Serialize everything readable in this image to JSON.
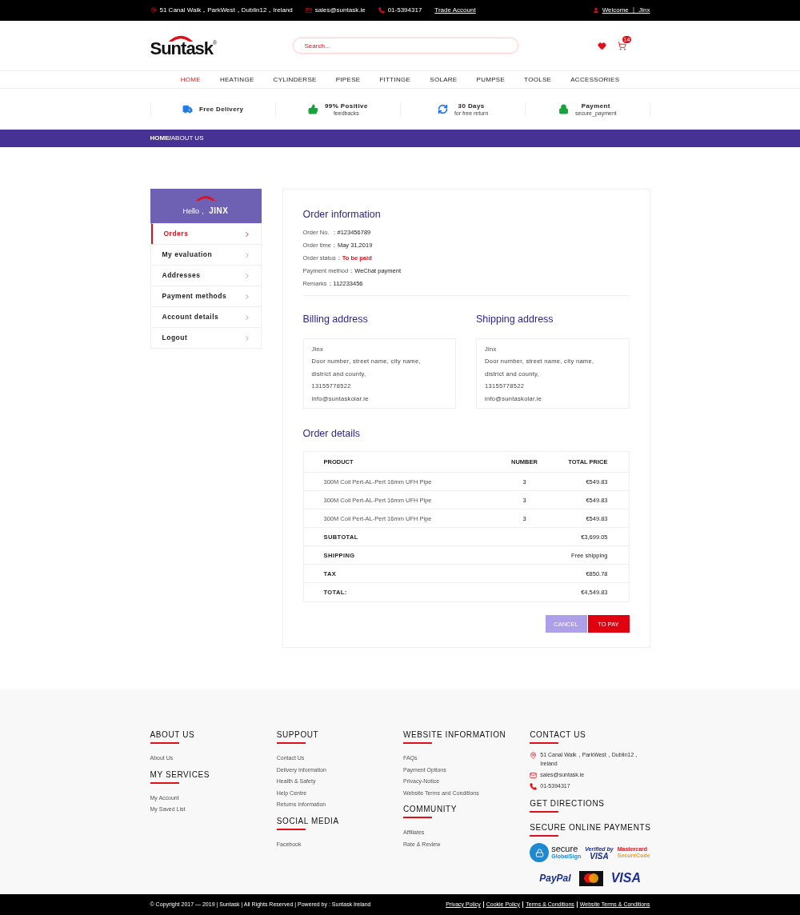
{
  "top_bar": {
    "address": "51 Canal Walk，ParkWest，Dublin12，Ireland",
    "email": "sales@suntask.ie",
    "phone": "01-5394317",
    "trade_account": "Trade Account",
    "welcome": "Welcome ｜ Jinx"
  },
  "header": {
    "logo": "Suntask",
    "logo_mark": "®",
    "search": {
      "placeholder": "Search..."
    },
    "cart_count": "14"
  },
  "nav": [
    {
      "label": "HOME",
      "selected": true
    },
    {
      "label": "HEATINGE",
      "selected": false
    },
    {
      "label": "CYLINDERSE",
      "selected": false
    },
    {
      "label": "PIPESE",
      "selected": false
    },
    {
      "label": "FITTINGE",
      "selected": false
    },
    {
      "label": "SOLARE",
      "selected": false
    },
    {
      "label": "PUMPSE",
      "selected": false
    },
    {
      "label": "TOOLSE",
      "selected": false
    },
    {
      "label": "ACCESSORIES",
      "selected": false
    }
  ],
  "features": [
    {
      "kind": "truck",
      "title": "Free Delivery"
    },
    {
      "kind": "thumb",
      "title": "99% Positive",
      "subtitle": "feedbacks"
    },
    {
      "kind": "refresh",
      "title": "30 Days",
      "subtitle": "for free return"
    },
    {
      "kind": "lock",
      "title": "Payment",
      "subtitle": "secure_payment"
    }
  ],
  "breadcrumb": "**HOME/**ABOUT US",
  "sidebar": {
    "greeting": "Hello，",
    "name": "JINX",
    "items": [
      {
        "label": "Orders",
        "selected": true
      },
      {
        "label": "My evaluation",
        "selected": false
      },
      {
        "label": "Addresses",
        "selected": false
      },
      {
        "label": "Payment methods",
        "selected": false
      },
      {
        "label": "Account details",
        "selected": false
      },
      {
        "label": "Logout",
        "selected": false
      }
    ]
  },
  "order_info": {
    "title": "Order information",
    "fields": [
      {
        "label": "Order No. ：",
        "value": "#123456789",
        "kind": "plain"
      },
      {
        "label": "Order time：",
        "value": "May 31,2019",
        "kind": "plain"
      },
      {
        "label": "Order status：",
        "value": "To be paid",
        "kind": "alert"
      },
      {
        "label": "Payment method：",
        "value": "WeChat payment",
        "kind": "plain"
      },
      {
        "label": "Remarks：",
        "value": "112233456",
        "kind": "plain"
      }
    ]
  },
  "addresses": [
    {
      "title": "Billing address",
      "lines": [
        "Jinx",
        "Door number, street name, city name,",
        "district and county,",
        "13155778522",
        "info@suntaskolar.ie"
      ]
    },
    {
      "title": "Shipping address",
      "lines": [
        "Jinx",
        "Door number, street name, city name,",
        "district and county,",
        "13155778522",
        "info@suntaskolar.ie"
      ]
    }
  ],
  "order_details": {
    "title": "Order details",
    "columns": [
      "PRODUCT",
      "NUMBER",
      "TOTAL PRICE"
    ],
    "rows": [
      [
        "300M Coil Pert-AL-Pert 16mm UFH Pipe",
        "3",
        "€549.83"
      ],
      [
        "300M Coil Pert-AL-Pert 16mm UFH Pipe",
        "3",
        "€549.83"
      ],
      [
        "300M Coil Pert-AL-Pert 16mm UFH Pipe",
        "3",
        "€549.83"
      ]
    ],
    "summary": [
      {
        "label": "SUBTOTAL",
        "value": "€3,699.05"
      },
      {
        "label": "SHIPPING",
        "value": "Free shipping"
      },
      {
        "label": "TAX",
        "value": "€850.78"
      },
      {
        "label": "TOTAL:",
        "value": "€4,549.83"
      }
    ]
  },
  "buttons": {
    "cancel": "CANCEL",
    "pay": "TO PAY"
  },
  "footer": {
    "columns": [
      [
        {
          "title": "ABOUT US",
          "links": [
            "About Us"
          ]
        },
        {
          "title": "MY SERVICES",
          "links": [
            "My Account",
            "My Saved List"
          ]
        }
      ],
      [
        {
          "title": "SUPPOUT",
          "links": [
            "Contact Us",
            "Delivery Information",
            "Health & Safety",
            "Help Centre",
            "Returns Information"
          ]
        },
        {
          "title": "SOCIAL MEDIA",
          "links": [
            "Facebook"
          ]
        }
      ],
      [
        {
          "title": "WEBSITE INFORMATION",
          "links": [
            "FAQs",
            "Payment Options",
            "Privacy-Notice",
            "Website Terms and Conditions"
          ]
        },
        {
          "title": "COMMUNITY",
          "links": [
            "Affiliates",
            "Rate & Review"
          ]
        }
      ]
    ],
    "contact": {
      "title": "CONTACT US",
      "items": [
        {
          "kind": "pin",
          "text": "51 Canal Walk，ParkWest，Dublin12，Ireland"
        },
        {
          "kind": "mail",
          "text": "sales@suntask.ie"
        },
        {
          "kind": "phone",
          "text": "01-5394317"
        }
      ]
    },
    "directions": "GET DIRECTIONS",
    "payments": {
      "title": "SECURE ONLINE PAYMENTS",
      "secure": "secure",
      "globalsign": "GlobalSign",
      "verified_by": "Verified by",
      "visa_verified": "VISA",
      "mastercard": "Mastercard",
      "securecode": "SecureCode",
      "paypal": "PayPal",
      "visa": "VISA"
    }
  },
  "bottom_bar": {
    "copyright": "© Copyright 2017 — 2019 | Suntask | All Rights Reserved | Powered by : Suntask Ireland",
    "links": [
      "Privacy Policy",
      "Cookie Policy",
      "Terms & Conditions",
      "Website Terms & Conditions"
    ]
  }
}
